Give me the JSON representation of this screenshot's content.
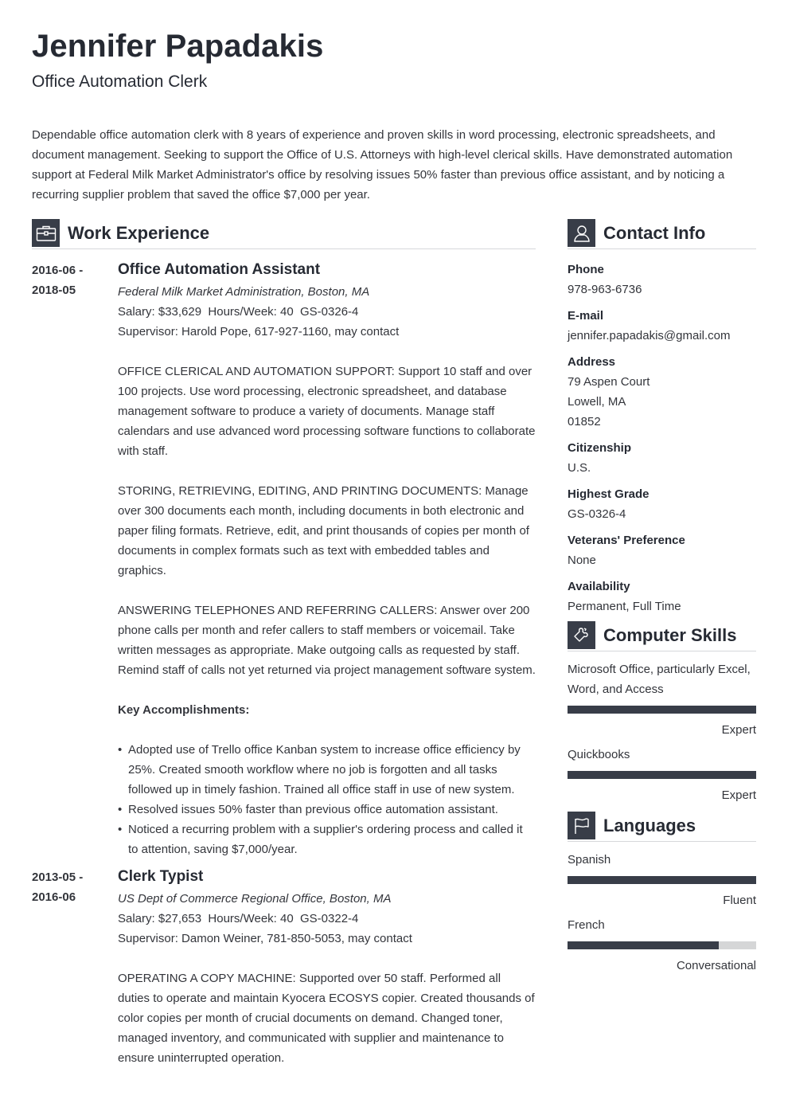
{
  "header": {
    "name": "Jennifer Papadakis",
    "title": "Office Automation Clerk"
  },
  "summary": "Dependable office automation clerk with 8 years of experience and proven skills in word processing, electronic spreadsheets, and document management. Seeking to support the Office of U.S. Attorneys with high-level clerical skills. Have demonstrated automation support at Federal Milk Market Administrator's office by resolving issues 50% faster than previous office assistant, and by noticing a recurring supplier problem that saved the office $7,000 per year.",
  "work": {
    "heading": "Work Experience",
    "icon": "briefcase-icon",
    "jobs": [
      {
        "date_start": "2016-06 -",
        "date_end": "2018-05",
        "role": "Office Automation Assistant",
        "org": "Federal Milk Market Administration, Boston, MA",
        "salary_line": "Salary: $33,629  Hours/Week: 40  GS-0326-4",
        "supervisor": "Supervisor: Harold Pope, 617-927-1160, may contact",
        "paragraphs": [
          "OFFICE CLERICAL AND AUTOMATION SUPPORT: Support 10 staff and over 100 projects. Use word processing, electronic spreadsheet, and database management software to produce a variety of documents. Manage staff calendars and use advanced word processing software functions to collaborate with staff.",
          "STORING, RETRIEVING, EDITING, AND PRINTING DOCUMENTS: Manage over 300 documents each month, including documents in both electronic and paper filing formats. Retrieve, edit, and print thousands of copies per month of documents in complex formats such as text with embedded tables and graphics.",
          "ANSWERING TELEPHONES AND REFERRING CALLERS: Answer over 200 phone calls per month and refer callers to staff members or voicemail. Take written messages as appropriate. Make outgoing calls as requested by staff. Remind staff of calls not yet returned via project management software system."
        ],
        "accomplishments_label": "Key Accomplishments:",
        "accomplishments": [
          "Adopted use of Trello office Kanban system to increase office efficiency by 25%. Created smooth workflow where no job is forgotten and all tasks followed up in timely fashion. Trained all office staff in use of new system.",
          "Resolved issues 50% faster than previous office automation assistant.",
          "Noticed a recurring problem with a supplier's ordering process and called it to attention, saving $7,000/year."
        ]
      },
      {
        "date_start": "2013-05 -",
        "date_end": "2016-06",
        "role": "Clerk Typist",
        "org": "US Dept of Commerce Regional Office, Boston, MA",
        "salary_line": "Salary: $27,653  Hours/Week: 40  GS-0322-4",
        "supervisor": "Supervisor: Damon Weiner, 781-850-5053, may contact",
        "paragraphs": [
          "OPERATING A COPY MACHINE: Supported over 50 staff. Performed all duties to operate and maintain Kyocera ECOSYS copier. Created thousands of color copies per month of crucial documents on demand. Changed toner, managed inventory, and communicated with supplier and maintenance to ensure uninterrupted operation."
        ]
      }
    ]
  },
  "contact": {
    "heading": "Contact Info",
    "icon": "user-icon",
    "fields": [
      {
        "label": "Phone",
        "lines": [
          "978-963-6736"
        ]
      },
      {
        "label": "E-mail",
        "lines": [
          "jennifer.papadakis@gmail.com"
        ]
      },
      {
        "label": "Address",
        "lines": [
          "79 Aspen Court",
          "Lowell, MA",
          "01852"
        ]
      },
      {
        "label": "Citizenship",
        "lines": [
          "U.S."
        ]
      },
      {
        "label": "Highest Grade",
        "lines": [
          "GS-0326-4"
        ]
      },
      {
        "label": "Veterans' Preference",
        "lines": [
          "None"
        ]
      },
      {
        "label": "Availability",
        "lines": [
          "Permanent, Full Time"
        ]
      }
    ]
  },
  "skills": {
    "heading": "Computer Skills",
    "icon": "puzzle-icon",
    "items": [
      {
        "name": "Microsoft Office, particularly Excel, Word, and Access",
        "level": "Expert",
        "proficiency": 1.0
      },
      {
        "name": "Quickbooks",
        "level": "Expert",
        "proficiency": 1.0
      }
    ]
  },
  "languages": {
    "heading": "Languages",
    "icon": "flag-icon",
    "items": [
      {
        "name": "Spanish",
        "level": "Fluent",
        "proficiency": 1.0
      },
      {
        "name": "French",
        "level": "Conversational",
        "proficiency": 0.8
      }
    ]
  }
}
